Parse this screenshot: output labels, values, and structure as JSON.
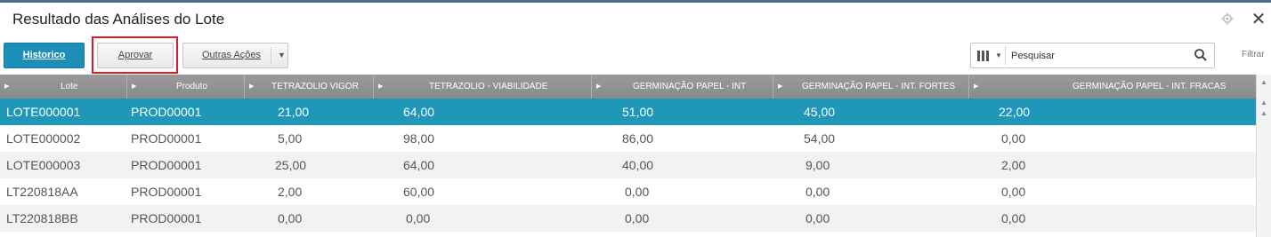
{
  "window": {
    "title": "Resultado das Análises do Lote",
    "settings_icon": "gear-icon",
    "close_label": "✕"
  },
  "toolbar": {
    "historico_label": "Historico",
    "aprovar_label": "Aprovar",
    "outras_acoes_label": "Outras Ações",
    "accent_color": "#1b8fb8",
    "highlight_color": "#e01b22"
  },
  "search": {
    "value": "",
    "placeholder": "Pesquisar",
    "filter_label": "Filtrar"
  },
  "table": {
    "columns": [
      "Lote",
      "Produto",
      "TETRAZOLIO VIGOR",
      "TETRAZOLIO - VIABILIDADE",
      "GERMINAÇÃO PAPEL - INT",
      "GERMINAÇÃO PAPEL - INT. FORTES",
      "GERMINAÇÃO PAPEL - INT. FRACAS"
    ],
    "rows": [
      [
        "LOTE000001",
        "PROD00001",
        "21,00",
        "64,00",
        "51,00",
        "45,00",
        "22,00"
      ],
      [
        "LOTE000002",
        "PROD00001",
        "5,00",
        "98,00",
        "86,00",
        "54,00",
        "0,00"
      ],
      [
        "LOTE000003",
        "PROD00001",
        "25,00",
        "64,00",
        "40,00",
        "9,00",
        "2,00"
      ],
      [
        "LT220818AA",
        "PROD00001",
        "2,00",
        "60,00",
        "0,00",
        "0,00",
        "0,00"
      ],
      [
        "LT220818BB",
        "PROD00001",
        "0,00",
        "0,00",
        "0,00",
        "0,00",
        "0,00"
      ]
    ],
    "selected_row_color": "#1f97b9"
  }
}
